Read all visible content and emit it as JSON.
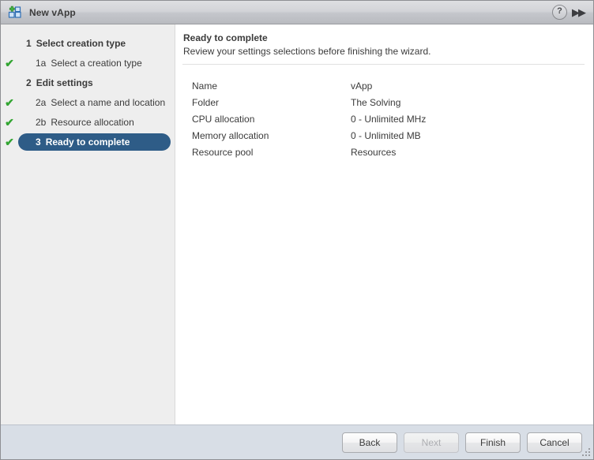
{
  "window": {
    "title": "New vApp",
    "icon": "vapp-add-icon",
    "help_label": "?",
    "collapse_label": "▶▶"
  },
  "sidebar": {
    "items": [
      {
        "number": "1",
        "label": "Select creation type",
        "type": "group",
        "checked": false,
        "selected": false
      },
      {
        "number": "1a",
        "label": "Select a creation type",
        "type": "sub",
        "checked": true,
        "selected": false
      },
      {
        "number": "2",
        "label": "Edit settings",
        "type": "group",
        "checked": false,
        "selected": false
      },
      {
        "number": "2a",
        "label": "Select a name and location",
        "type": "sub",
        "checked": true,
        "selected": false
      },
      {
        "number": "2b",
        "label": "Resource allocation",
        "type": "sub",
        "checked": true,
        "selected": false
      },
      {
        "number": "3",
        "label": "Ready to complete",
        "type": "group",
        "checked": true,
        "selected": true
      }
    ]
  },
  "main": {
    "title": "Ready to complete",
    "subtitle": "Review your settings selections before finishing the wizard.",
    "summary": [
      {
        "label": "Name",
        "value": "vApp"
      },
      {
        "label": "Folder",
        "value": "The Solving"
      },
      {
        "label": "CPU allocation",
        "value": "0 - Unlimited MHz"
      },
      {
        "label": "Memory allocation",
        "value": "0 - Unlimited MB"
      },
      {
        "label": "Resource pool",
        "value": "Resources"
      }
    ]
  },
  "footer": {
    "buttons": [
      {
        "label": "Back",
        "disabled": false
      },
      {
        "label": "Next",
        "disabled": true
      },
      {
        "label": "Finish",
        "disabled": false
      },
      {
        "label": "Cancel",
        "disabled": false
      }
    ]
  },
  "colors": {
    "selected_pill": "#2e5c87",
    "check_green": "#33a532",
    "sidebar_bg": "#eeeeee",
    "footer_bg": "#d8dee6",
    "text": "#3b3b3b"
  }
}
